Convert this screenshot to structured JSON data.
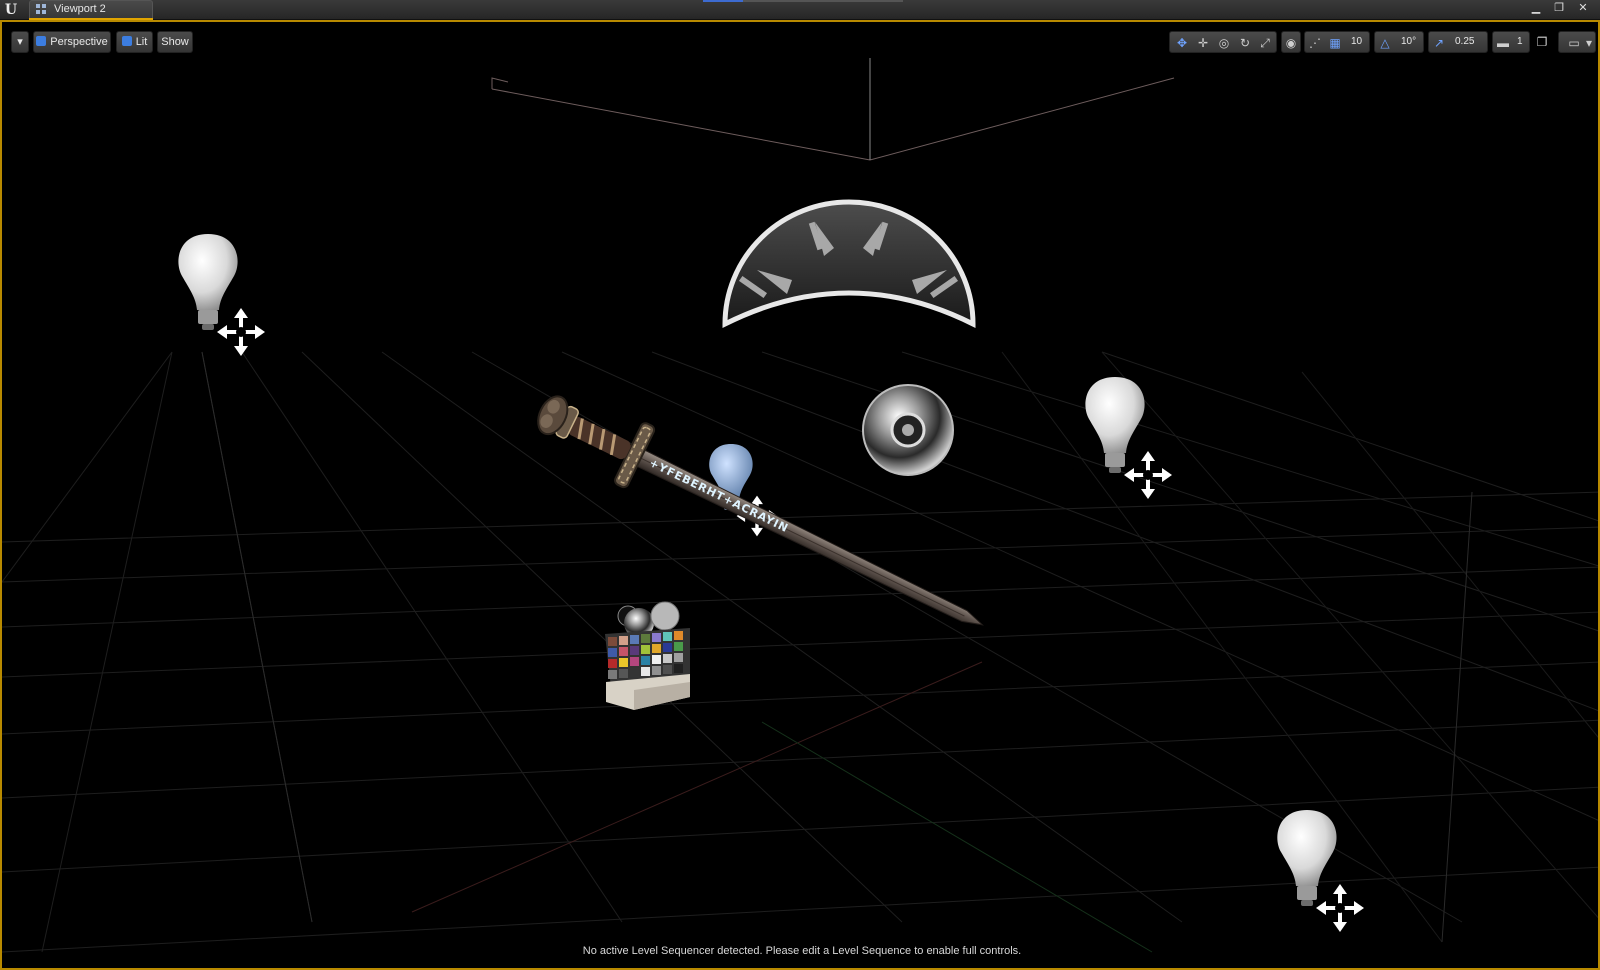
{
  "window": {
    "tab_title": "Viewport 2",
    "app_logo": "unreal-engine-logo",
    "controls": [
      "minimize",
      "restore",
      "close"
    ]
  },
  "toolbar": {
    "options_icon": "chevron-down-icon",
    "perspective_label": "Perspective",
    "lit_label": "Lit",
    "show_label": "Show",
    "grid_snap_value": "10",
    "rotation_snap_value": "10°",
    "scale_snap_value": "0.25",
    "camera_speed_value": "1",
    "icons": [
      "translate-icon",
      "rotate-icon",
      "scale-icon",
      "world-local-icon",
      "surface-snap-icon",
      "grid-snap-icon",
      "rotation-snap-icon",
      "scale-snap-icon",
      "camera-speed-icon",
      "maximize-icon",
      "layout-icon"
    ]
  },
  "status": {
    "message": "No active Level Sequencer detected. Please edit a Level Sequence to enable full controls."
  },
  "scene": {
    "blade_inscription": "+YFEBERHT+ACRAYIN",
    "objects": [
      "point-light-icon",
      "skylight-dome-icon",
      "reflection-capture-sphere",
      "sword-mesh",
      "color-checker-cube"
    ]
  },
  "colors": {
    "viewport_border": "#b88a00",
    "active_tab_accent": "#e0a400",
    "toolbar_accent": "#3c7de0"
  }
}
